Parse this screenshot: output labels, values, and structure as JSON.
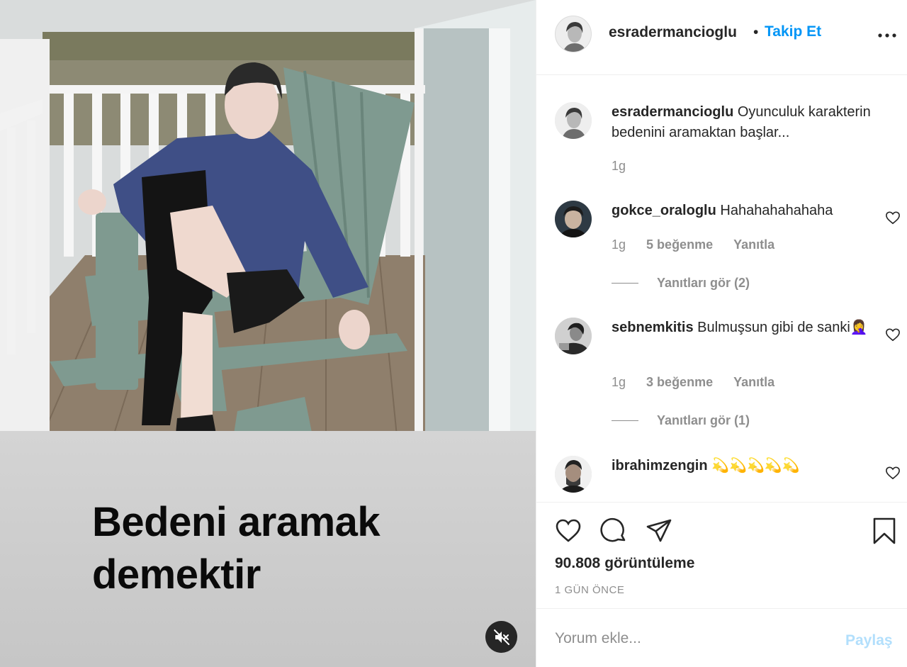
{
  "post": {
    "username": "esradermancioglu",
    "follow_separator": "•",
    "follow_label": "Takip Et",
    "caption_overlay": [
      "Bedeni aramak",
      "demektir"
    ],
    "muted": true
  },
  "comments": [
    {
      "username": "esradermancioglu",
      "text": "Oyunculuk karakterin bedenini aramaktan başlar...",
      "time": "1g",
      "is_caption": true
    },
    {
      "username": "gokce_oraloglu",
      "text": "Hahahahahahaha",
      "time": "1g",
      "likes": "5 beğenme",
      "reply_label": "Yanıtla",
      "view_replies": "Yanıtları gör (2)"
    },
    {
      "username": "sebnemkitis",
      "text": "Bulmuşsun gibi de sanki🤦‍♀️",
      "time": "1g",
      "likes": "3 beğenme",
      "reply_label": "Yanıtla",
      "view_replies": "Yanıtları gör (1)"
    },
    {
      "username": "ibrahimzengin",
      "text": "💫💫💫💫💫"
    }
  ],
  "actions": {
    "like_icon": "heart-icon",
    "comment_icon": "comment-icon",
    "share_icon": "share-icon",
    "save_icon": "bookmark-icon"
  },
  "stats": {
    "views_count": "90.808",
    "views_label": "görüntüleme",
    "date": "1 GÜN ÖNCE"
  },
  "add_comment": {
    "placeholder": "Yorum ekle...",
    "post_label": "Paylaş"
  },
  "colors": {
    "link": "#0095f6",
    "muted_text": "#8e8e8e",
    "post_disabled": "#b2dffc"
  }
}
